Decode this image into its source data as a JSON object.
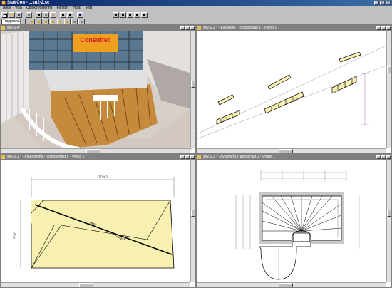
{
  "app": {
    "title": "StairCon - ...sn2-2.sc"
  },
  "menu": [
    "Arkiv",
    "Visa",
    "Objektredigering",
    "Fönster",
    "Hjälp",
    "Test"
  ],
  "toolbar": {
    "combo_value": "Trappschakt 1"
  },
  "windows": {
    "view3d": {
      "title": "sn2-2.4 *"
    },
    "elevation": {
      "title": "sn2-2.2 * - Elevation - Trappschakt 1 - Vfiling 1"
    },
    "plan": {
      "title": "sn2-2.1 * - Planlösning - Trappschakt 1 - Vfiling 1"
    },
    "layout": {
      "title": "sn2-2.3 * - Avfallning Trappschakt 1 - Vfiling 1"
    }
  },
  "view3d": {
    "sign_text": "Consultec"
  },
  "plan": {
    "dim_width": "1050",
    "dim_height": "590",
    "label_top": "L: 2963",
    "label_bottom": "Steg: 6"
  },
  "colors": {
    "accent": "#0a246a",
    "stair_fill": "#f7f0b0",
    "dim_line": "#808080",
    "sign": "#f0a020",
    "sign_text": "#d02020"
  }
}
